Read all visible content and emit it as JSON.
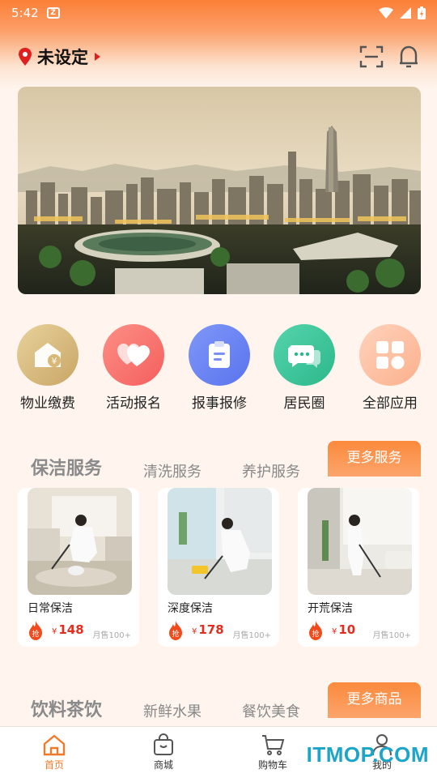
{
  "status_bar": {
    "time": "5:42"
  },
  "header": {
    "location": "未设定"
  },
  "quick_actions": [
    {
      "label": "物业缴费",
      "icon": "house-yen-icon",
      "color": "#dcc184"
    },
    {
      "label": "活动报名",
      "icon": "hearts-icon",
      "color": "#fb7772"
    },
    {
      "label": "报事报修",
      "icon": "clipboard-icon",
      "color": "#6a86f5"
    },
    {
      "label": "居民圈",
      "icon": "chat-bubble-icon",
      "color": "#41c69c"
    },
    {
      "label": "全部应用",
      "icon": "grid-apps-icon",
      "color": "#fdc4a7"
    }
  ],
  "service_section": {
    "tabs": [
      "保洁服务",
      "清洗服务",
      "养护服务"
    ],
    "more_label": "更多服务",
    "items": [
      {
        "name": "日常保洁",
        "currency": "¥",
        "price": "148",
        "sold": "月售100+"
      },
      {
        "name": "深度保洁",
        "currency": "¥",
        "price": "178",
        "sold": "月售100+"
      },
      {
        "name": "开荒保洁",
        "currency": "¥",
        "price": "10",
        "sold": "月售100+"
      }
    ],
    "badge": "抢"
  },
  "goods_section": {
    "tabs": [
      "饮料茶饮",
      "新鲜水果",
      "餐饮美食"
    ],
    "more_label": "更多商品"
  },
  "tab_bar": [
    {
      "label": "首页",
      "icon": "home-icon",
      "active": true
    },
    {
      "label": "商城",
      "icon": "shopping-bag-icon",
      "active": false
    },
    {
      "label": "购物车",
      "icon": "cart-icon",
      "active": false
    },
    {
      "label": "我的",
      "icon": "user-icon",
      "active": false
    }
  ],
  "watermark": "ITMOP.COM",
  "colors": {
    "accent": "#f07a2a",
    "price": "#e52d1e",
    "location_pin": "#e0201e"
  }
}
